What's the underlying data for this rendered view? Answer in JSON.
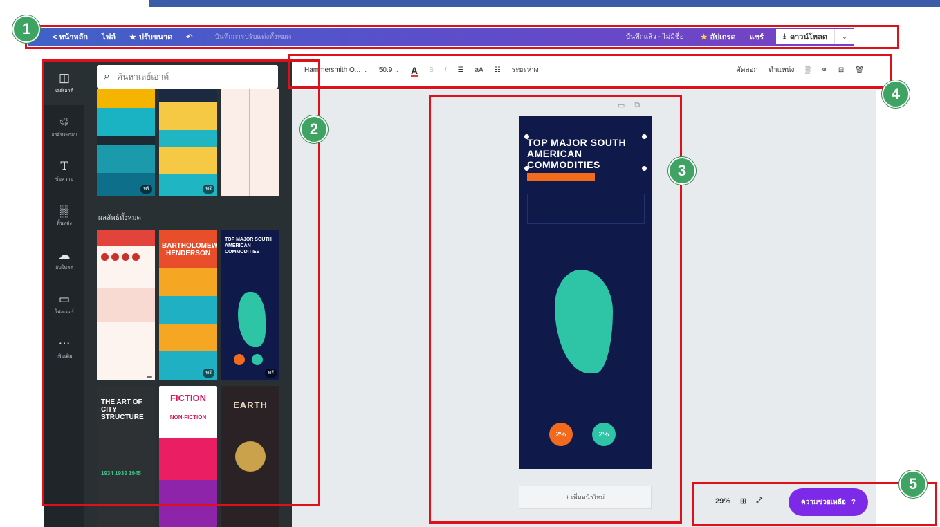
{
  "header": {
    "home": "< หน้าหลัก",
    "file": "ไฟล์",
    "resize": "ปรับขนาด",
    "undo_icon": "undo-icon",
    "title_placeholder": "บันทึกการปรับแต่งทั้งหมด",
    "saved": "บันทึกแล้ว - ไม่มีชื่อ",
    "upgrade": "อัปเกรด",
    "share": "แชร์",
    "download": "ดาวน์โหลด"
  },
  "leftnav": {
    "items": [
      {
        "label": "เลย์เอาต์",
        "icon": "layout-icon"
      },
      {
        "label": "องค์ประกอบ",
        "icon": "elements-icon"
      },
      {
        "label": "ข้อความ",
        "icon": "text-icon"
      },
      {
        "label": "พื้นหลัง",
        "icon": "background-icon"
      },
      {
        "label": "อัปโหลด",
        "icon": "upload-icon"
      },
      {
        "label": "โฟลเดอร์",
        "icon": "folder-icon"
      },
      {
        "label": "เพิ่มเติม",
        "icon": "more-icon"
      }
    ]
  },
  "sidepanel": {
    "search_placeholder": "ค้นหาเลย์เอาต์",
    "section_label": "ผลลัพธ์ทั้งหมด",
    "thumbs": [
      {
        "title": "",
        "badge": "ฟรี"
      },
      {
        "title": "",
        "badge": "ฟรี"
      },
      {
        "title": "",
        "badge": ""
      },
      {
        "title": "BARTHOLOMEW HENDERSON",
        "badge": ""
      },
      {
        "title": "",
        "badge": "ฟรี"
      },
      {
        "title": "TOP MAJOR SOUTH AMERICAN COMMODITIES",
        "badge": "ฟรี"
      },
      {
        "title": "THE ART OF CITY STRUCTURE",
        "badge": ""
      },
      {
        "title": "FICTION",
        "badge": ""
      },
      {
        "title": "EARTH",
        "badge": ""
      }
    ],
    "thumb_subtitle": "NON-FICTION",
    "years": "1934  1939  1945"
  },
  "toolbar": {
    "font": "Hammersmith O...",
    "size": "50.9",
    "bold": "B",
    "italic": "I",
    "case": "aA",
    "spacing": "ระยะห่าง",
    "copy": "คัดลอก",
    "position": "ตำแหน่ง"
  },
  "page": {
    "title": "TOP MAJOR SOUTH AMERICAN COMMODITIES",
    "stat1": "2%",
    "stat2": "2%",
    "add_page": "+ เพิ่มหน้าใหม่"
  },
  "bottom": {
    "zoom": "29%",
    "help": "ความช่วยเหลือ",
    "help_icon": "?"
  },
  "annotations": [
    "1",
    "2",
    "3",
    "4",
    "5"
  ],
  "colors": {
    "accent": "#7d2ae8",
    "annotation_red": "#e0101a",
    "annotation_green": "#3fa463",
    "header_start": "#3f62c8",
    "header_end": "#7a3fc3"
  }
}
